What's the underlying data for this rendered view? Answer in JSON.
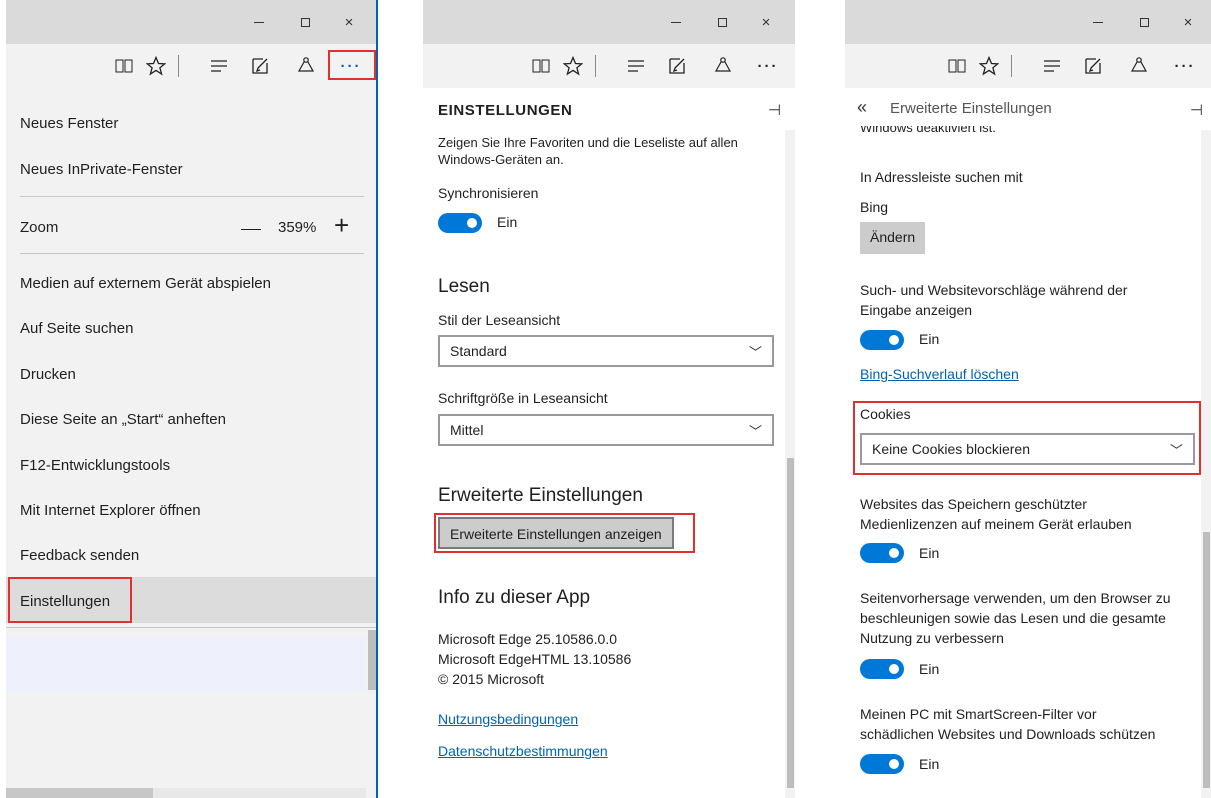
{
  "window": {
    "minimize_label": "–",
    "maximize_label": "☐",
    "close_label": "×"
  },
  "toolbar": {
    "icons": [
      "reading-view-icon",
      "favorites-star-icon",
      "hub-icon",
      "web-note-icon",
      "share-icon",
      "more-icon"
    ],
    "more_label": "···"
  },
  "menu": {
    "new_window": "Neues Fenster",
    "new_inprivate": "Neues InPrivate-Fenster",
    "zoom_label": "Zoom",
    "zoom_value": "359%",
    "zoom_minus": "—",
    "zoom_plus": "+",
    "cast_media": "Medien auf externem Gerät abspielen",
    "find_on_page": "Auf Seite suchen",
    "print": "Drucken",
    "pin_to_start": "Diese Seite an „Start“ anheften",
    "f12_tools": "F12-Entwicklungstools",
    "open_with_ie": "Mit Internet Explorer öffnen",
    "send_feedback": "Feedback senden",
    "settings": "Einstellungen"
  },
  "settings": {
    "title": "EINSTELLUNGEN",
    "pin_label": "⊣",
    "sync_desc_line1": "Zeigen Sie Ihre Favoriten und die Leseliste auf allen",
    "sync_desc_line2": "Windows-Geräten an.",
    "sync_label": "Synchronisieren",
    "sync_toggle_state": "Ein",
    "reading_heading": "Lesen",
    "reading_style_label": "Stil der Leseansicht",
    "reading_style_value": "Standard",
    "font_size_label": "Schriftgröße in Leseansicht",
    "font_size_value": "Mittel",
    "advanced_heading": "Erweiterte Einstellungen",
    "advanced_button": "Erweiterte Einstellungen anzeigen",
    "about_heading": "Info zu dieser App",
    "about_edge": "Microsoft Edge 25.10586.0.0",
    "about_edgehtml": "Microsoft EdgeHTML 13.10586",
    "about_copyright": "© 2015 Microsoft",
    "terms_link": "Nutzungsbedingungen",
    "privacy_link": "Datenschutzbestimmungen"
  },
  "advanced": {
    "back_label": "«",
    "title": "Erweiterte Einstellungen",
    "pin_label": "⊣",
    "clipped_text": "Windows deaktiviert ist.",
    "search_in_label": "In Adressleiste suchen mit",
    "search_engine": "Bing",
    "change_button": "Ändern",
    "suggestions_line1": "Such- und Websitevorschläge während der",
    "suggestions_line2": "Eingabe anzeigen",
    "suggestions_state": "Ein",
    "clear_bing_link": "Bing-Suchverlauf löschen",
    "cookies_label": "Cookies",
    "cookies_value": "Keine Cookies blockieren",
    "media_licenses_line1": "Websites das Speichern geschützter",
    "media_licenses_line2": "Medienlizenzen auf meinem Gerät erlauben",
    "media_licenses_state": "Ein",
    "prediction_line1": "Seitenvorhersage verwenden, um den Browser zu",
    "prediction_line2": "beschleunigen sowie das Lesen und die gesamte",
    "prediction_line3": "Nutzung zu verbessern",
    "prediction_state": "Ein",
    "smartscreen_line1": "Meinen PC mit SmartScreen-Filter vor",
    "smartscreen_line2": "schädlichen Websites und Downloads schützen",
    "smartscreen_state": "Ein"
  },
  "colors": {
    "accent": "#0078d7",
    "link": "#0063b1",
    "highlight_box": "#e03030"
  }
}
